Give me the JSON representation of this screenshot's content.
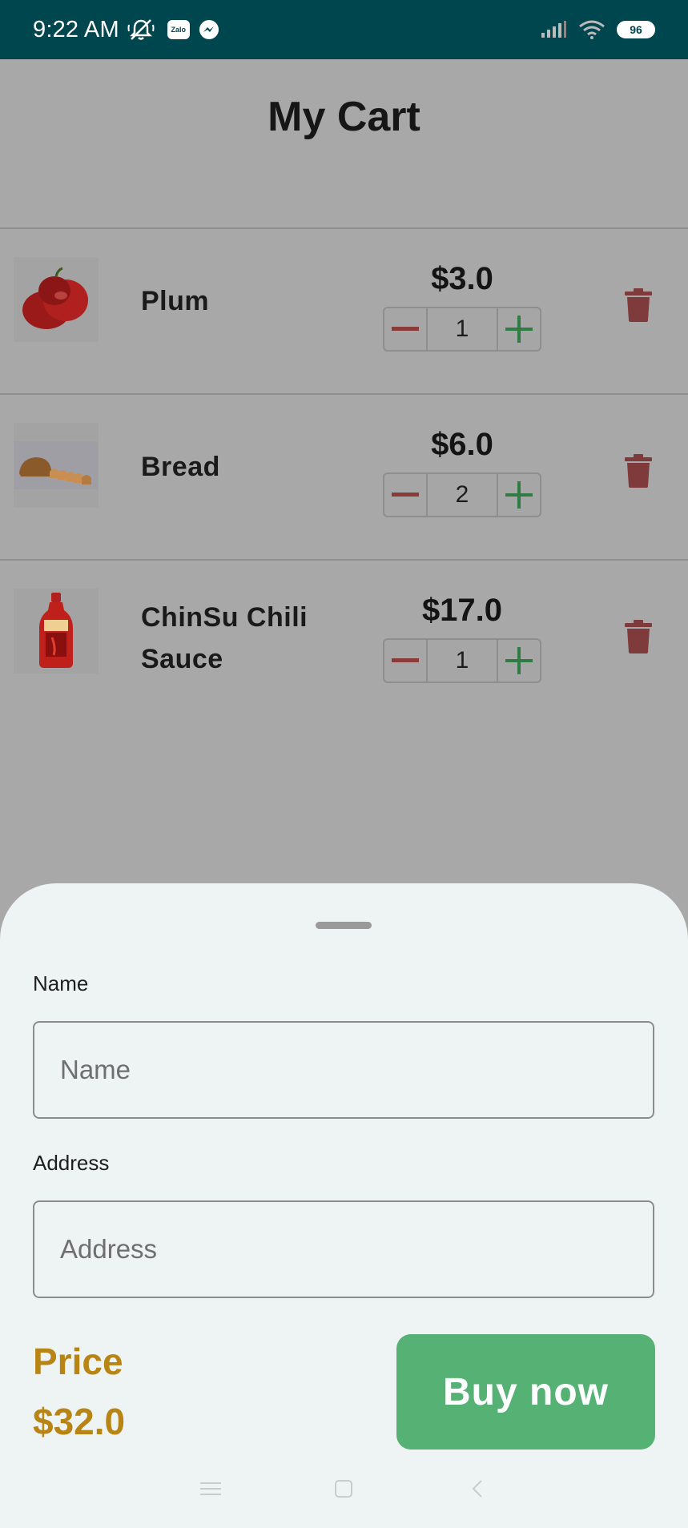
{
  "status_bar": {
    "time": "9:22 AM",
    "icons": [
      "mute-icon",
      "zalo-icon",
      "messenger-icon",
      "signal-icon",
      "wifi-icon",
      "battery-icon"
    ],
    "zalo_label": "Zalo",
    "battery_level": "96"
  },
  "header": {
    "title": "My Cart"
  },
  "cart": {
    "items": [
      {
        "name": "Plum",
        "price": "$3.0",
        "quantity": "1",
        "image": "plum-image"
      },
      {
        "name": "Bread",
        "price": "$6.0",
        "quantity": "2",
        "image": "bread-image"
      },
      {
        "name": "ChinSu Chili Sauce",
        "price": "$17.0",
        "quantity": "1",
        "image": "chili-sauce-image"
      }
    ]
  },
  "checkout": {
    "name_label": "Name",
    "name_placeholder": "Name",
    "address_label": "Address",
    "address_placeholder": "Address",
    "price_label": "Price",
    "price_value": "$32.0",
    "buy_label": "Buy now"
  },
  "colors": {
    "status_bar": "#00464f",
    "accent_price": "#b88514",
    "buy_button": "#56b174",
    "minus": "#8b3a3a",
    "plus": "#2f7d45",
    "trash": "#7f3b3b"
  },
  "nav_bar": {
    "icons": [
      "menu-icon",
      "home-icon",
      "back-icon"
    ]
  }
}
